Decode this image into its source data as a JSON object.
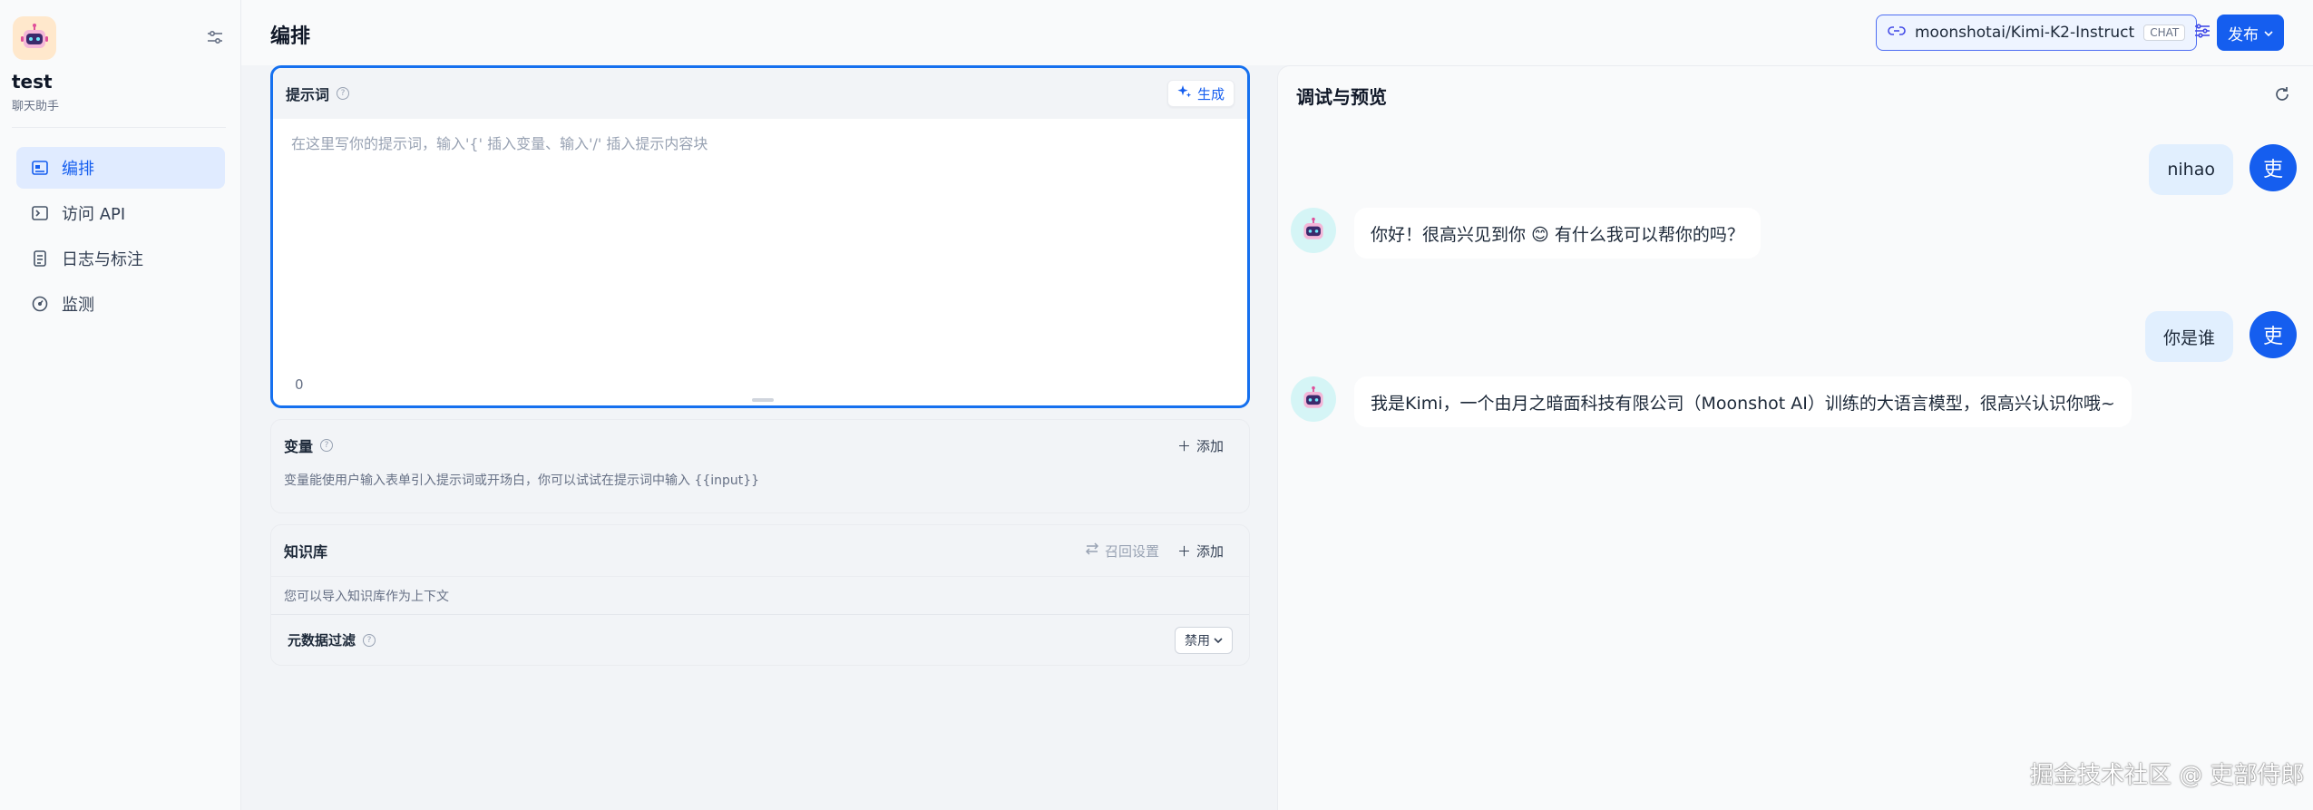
{
  "app": {
    "name": "test",
    "type": "聊天助手"
  },
  "sidebar": {
    "items": [
      {
        "label": "编排",
        "icon": "layout-icon",
        "active": true
      },
      {
        "label": "访问 API",
        "icon": "terminal-icon",
        "active": false
      },
      {
        "label": "日志与标注",
        "icon": "document-icon",
        "active": false
      },
      {
        "label": "监测",
        "icon": "gauge-icon",
        "active": false
      }
    ]
  },
  "header": {
    "title": "编排",
    "model_name": "moonshotai/Kimi-K2-Instruct",
    "model_tag": "CHAT",
    "publish_label": "发布"
  },
  "prompt": {
    "title": "提示词",
    "generate_label": "生成",
    "placeholder": "在这里写你的提示词，输入'{' 插入变量、输入'/' 插入提示内容块",
    "char_count": "0"
  },
  "variables": {
    "title": "变量",
    "add_label": "添加",
    "description": "变量能使用户输入表单引入提示词或开场白，你可以试试在提示词中输入 {{input}}"
  },
  "knowledge": {
    "title": "知识库",
    "recall_label": "召回设置",
    "add_label": "添加",
    "description": "您可以导入知识库作为上下文",
    "metadata_title": "元数据过滤",
    "metadata_value": "禁用"
  },
  "preview": {
    "title": "调试与预览",
    "messages": [
      {
        "role": "user",
        "text": "nihao",
        "avatar": "吏"
      },
      {
        "role": "assistant",
        "text": "你好！很高兴见到你 😊 有什么我可以帮你的吗？"
      },
      {
        "role": "user",
        "text": "你是谁",
        "avatar": "吏"
      },
      {
        "role": "assistant",
        "text": "我是Kimi，一个由月之暗面科技有限公司（Moonshot AI）训练的大语言模型，很高兴认识你哦~"
      }
    ]
  },
  "watermark": "掘金技术社区 @ 吏部侍郎",
  "colors": {
    "accent": "#155eef",
    "prompt_border": "#1570ef",
    "user_bubble": "#e1effe",
    "bot_avatar_bg": "#d5f5f6"
  }
}
